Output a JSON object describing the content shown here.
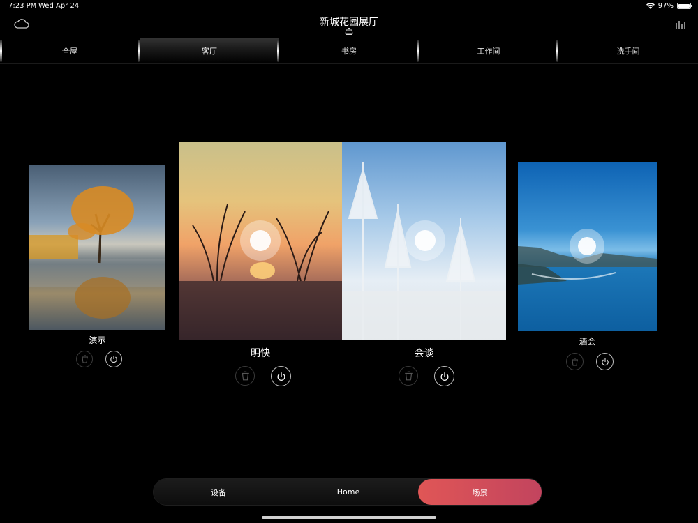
{
  "status_bar": {
    "time": "7:23 PM",
    "date": "Wed Apr 24",
    "battery": "97%",
    "battery_level": 0.97
  },
  "header": {
    "title": "新城花园展厅",
    "left_icon": "cloud-icon",
    "right_icon": "equalizer-icon",
    "sub_icon": "light-fixture-icon"
  },
  "tabs": [
    {
      "label": "全屋",
      "active": false
    },
    {
      "label": "客厅",
      "active": true
    },
    {
      "label": "书房",
      "active": false
    },
    {
      "label": "工作间",
      "active": false
    },
    {
      "label": "洗手间",
      "active": false
    }
  ],
  "scenes": [
    {
      "label": "演示",
      "photo": "tree-on-lake"
    },
    {
      "label": "明快",
      "photo": "sunset-grass"
    },
    {
      "label": "会谈",
      "photo": "snowy-trees"
    },
    {
      "label": "酒会",
      "photo": "coastline-sea"
    }
  ],
  "bottom_nav": [
    {
      "label": "设备",
      "active": false
    },
    {
      "label": "Home",
      "active": false
    },
    {
      "label": "场景",
      "active": true
    }
  ],
  "colors": {
    "accent": "#e05656",
    "background": "#000000"
  }
}
